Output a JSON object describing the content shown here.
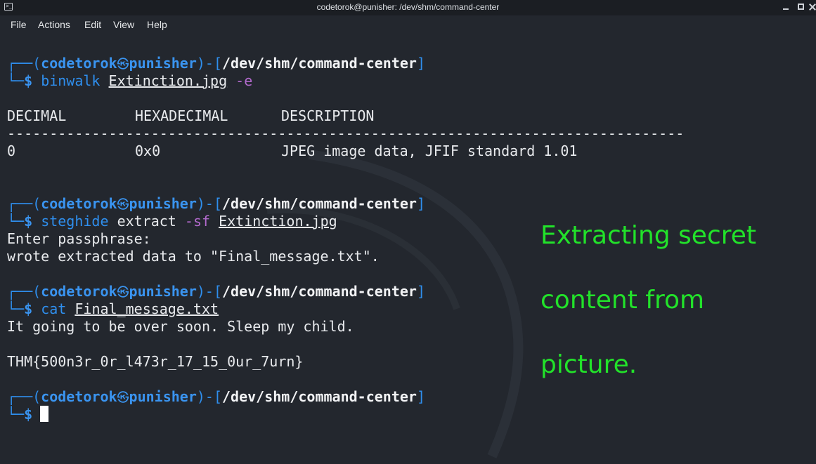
{
  "window": {
    "title": "codetorok@punisher: /dev/shm/command-center",
    "icon": "terminal-icon"
  },
  "menu": [
    "File",
    "Actions",
    "Edit",
    "View",
    "Help"
  ],
  "prompt": {
    "user": "codetorok",
    "host": "punisher",
    "skull_glyph": "㉿",
    "path": "/dev/shm/command-center",
    "top_prefix": "┌──(",
    "mid": ")-[",
    "close": "]",
    "bottom_prefix": "└─",
    "dollar": "$"
  },
  "commands": [
    {
      "cmd": "binwalk",
      "arg": "Extinction.jpg",
      "flag": "-e"
    },
    {
      "cmd": "steghide",
      "sub": "extract",
      "flag": "-sf",
      "arg": "Extinction.jpg"
    },
    {
      "cmd": "cat",
      "arg": "Final_message.txt"
    }
  ],
  "binwalk_table": {
    "headers": [
      "DECIMAL",
      "HEXADECIMAL",
      "DESCRIPTION"
    ],
    "separator": "--------------------------------------------------------------------------------",
    "rows": [
      [
        "0",
        "0x0",
        "JPEG image data, JFIF standard 1.01"
      ]
    ]
  },
  "steghide_output": [
    "Enter passphrase:",
    "wrote extracted data to \"Final_message.txt\"."
  ],
  "cat_output": [
    "It going to be over soon. Sleep my child.",
    "THM{500n3r_0r_l473r_17_15_0ur_7urn}"
  ],
  "annotation": [
    "Extracting secret",
    "content from",
    "picture."
  ],
  "colors": {
    "background": "#23272e",
    "prompt_blue": "#2f8fee",
    "flag_purple": "#b26acd",
    "annotation_green": "#22e22a"
  }
}
